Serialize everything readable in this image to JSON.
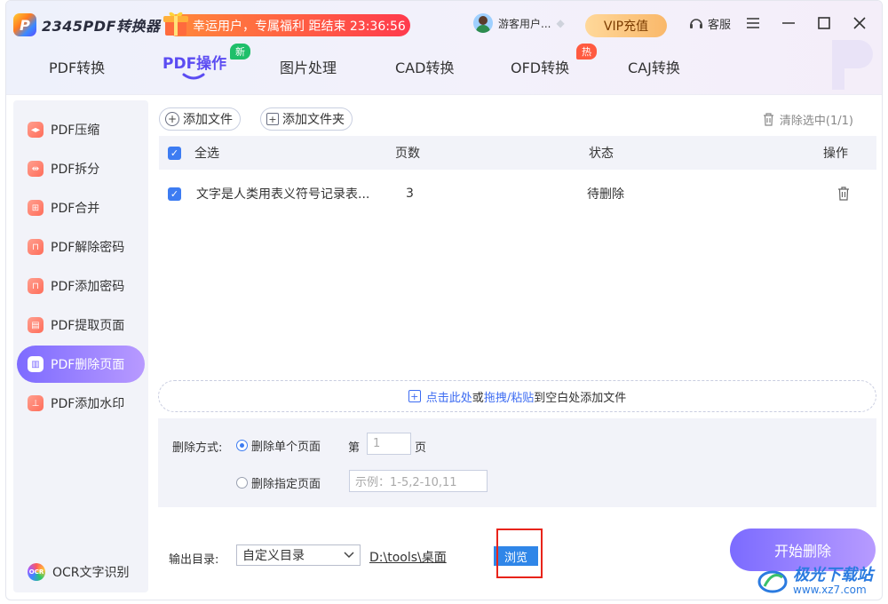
{
  "app": {
    "name": "2345PDF转换器",
    "logo_letter": "P"
  },
  "promo": {
    "text": "幸运用户，专属福利 距结束 23:36:56"
  },
  "user": {
    "name": "游客用户..."
  },
  "vip": {
    "label": "VIP充值"
  },
  "service": {
    "label": "客服"
  },
  "tabs": [
    {
      "label": "PDF转换"
    },
    {
      "label": "PDF操作",
      "badge": "新"
    },
    {
      "label": "图片处理"
    },
    {
      "label": "CAD转换"
    },
    {
      "label": "OFD转换",
      "badge": "热"
    },
    {
      "label": "CAJ转换"
    }
  ],
  "sidebar": {
    "items": [
      {
        "label": "PDF压缩",
        "icon": "compress-icon"
      },
      {
        "label": "PDF拆分",
        "icon": "split-icon"
      },
      {
        "label": "PDF合并",
        "icon": "merge-icon"
      },
      {
        "label": "PDF解除密码",
        "icon": "unlock-icon"
      },
      {
        "label": "PDF添加密码",
        "icon": "lock-icon"
      },
      {
        "label": "PDF提取页面",
        "icon": "extract-icon"
      },
      {
        "label": "PDF删除页面",
        "icon": "trash-icon",
        "active": true
      },
      {
        "label": "PDF添加水印",
        "icon": "stamp-icon"
      }
    ],
    "ocr": {
      "label": "OCR文字识别",
      "icon_text": "OCR"
    }
  },
  "toolbar": {
    "add_file": "添加文件",
    "add_folder": "添加文件夹",
    "clear": "清除选中(1/1)"
  },
  "table": {
    "headers": {
      "select_all": "全选",
      "pages": "页数",
      "status": "状态",
      "action": "操作"
    },
    "rows": [
      {
        "name": "文字是人类用表义符号记录表...",
        "pages": "3",
        "status": "待删除",
        "checked": true
      }
    ]
  },
  "dropzone": {
    "click_here": "点击此处",
    "or": "或",
    "drag": "拖拽/粘贴",
    "rest": "到空白处添加文件"
  },
  "options": {
    "mode_label": "删除方式:",
    "single_label": "删除单个页面",
    "page_prefix": "第",
    "page_value": "1",
    "page_suffix": "页",
    "range_label": "删除指定页面",
    "range_placeholder": "示例：1-5,2-10,11"
  },
  "output": {
    "label": "输出目录:",
    "dir_option": "自定义目录",
    "path": "D:\\tools\\桌面",
    "browse": "浏览"
  },
  "start_button": "开始删除",
  "site_watermark": {
    "name": "极光下载站",
    "url": "www.xz7.com"
  },
  "colors": {
    "accent": "#5b4cf2",
    "checkbox": "#3d7cf2",
    "highlight": "#e8241a"
  }
}
